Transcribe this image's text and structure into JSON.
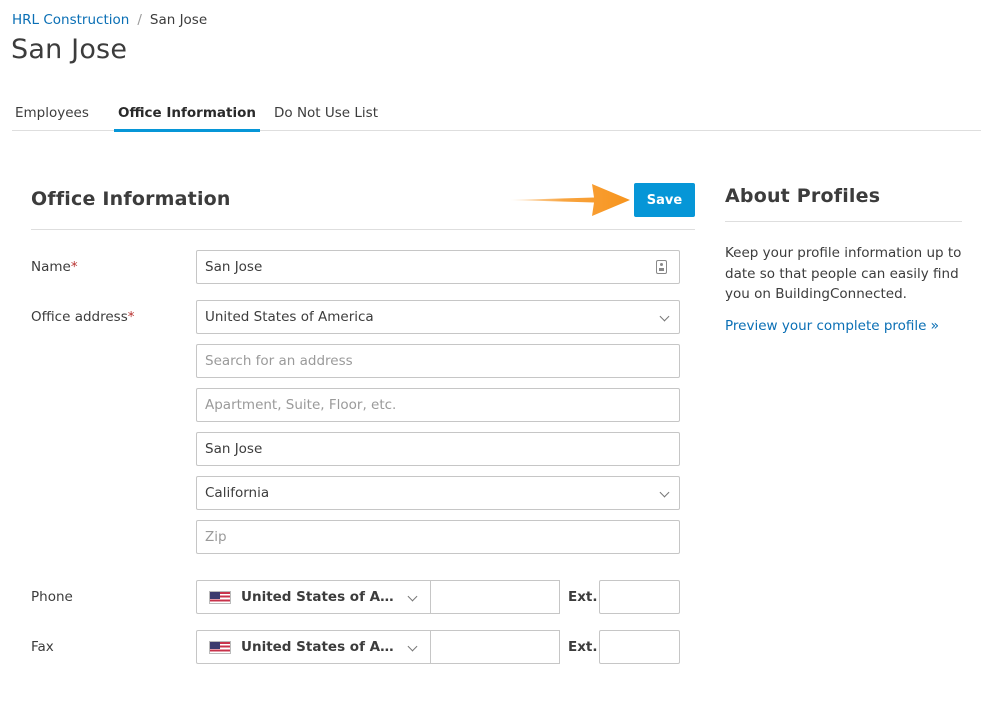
{
  "breadcrumb": {
    "parent": "HRL Construction",
    "separator": "/",
    "current": "San Jose"
  },
  "page_title": "San Jose",
  "tabs": [
    {
      "label": "Employees",
      "active": false
    },
    {
      "label": "Office Information",
      "active": true
    },
    {
      "label": "Do Not Use List",
      "active": false
    }
  ],
  "form": {
    "title": "Office Information",
    "save_label": "Save",
    "name": {
      "label": "Name",
      "required_mark": "*",
      "value": "San Jose",
      "icon": "contact-card-icon"
    },
    "address": {
      "label": "Office address",
      "required_mark": "*",
      "country": "United States of America",
      "search_placeholder": "Search for an address",
      "apartment_placeholder": "Apartment, Suite, Floor, etc.",
      "city": "San Jose",
      "state": "California",
      "zip_placeholder": "Zip"
    },
    "phone": {
      "label": "Phone",
      "country": "United States of America",
      "number": "",
      "ext_label": "Ext.",
      "ext": ""
    },
    "fax": {
      "label": "Fax",
      "country": "United States of America",
      "number": "",
      "ext_label": "Ext.",
      "ext": ""
    }
  },
  "about": {
    "title": "About Profiles",
    "text": "Keep your profile information up to date so that people can easily find you on BuildingConnected.",
    "link": "Preview your complete profile"
  },
  "colors": {
    "accent": "#0696d7",
    "link": "#0a6fb5",
    "required": "#b8312f",
    "arrow": "#f7941d"
  }
}
